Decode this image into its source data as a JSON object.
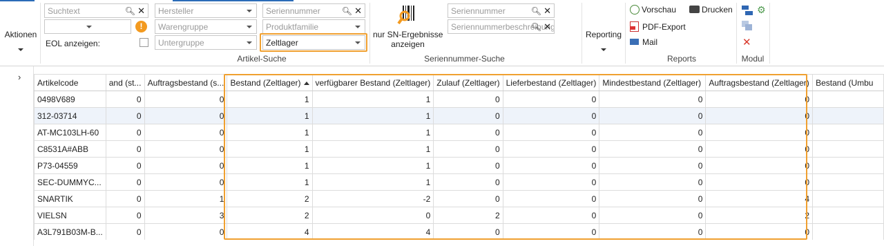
{
  "ribbon": {
    "aktionen": "Aktionen",
    "artikel_suche": {
      "group_label": "Artikel-Suche",
      "suchtext_placeholder": "Suchtext",
      "hersteller_placeholder": "Hersteller",
      "seriennummer_placeholder": "Seriennummer",
      "warengruppe_placeholder": "Warengruppe",
      "produktfamilie_placeholder": "Produktfamilie",
      "untergruppe_placeholder": "Untergruppe",
      "lager_value": "Zeltlager",
      "eol_label": "EOL anzeigen:",
      "info_icon_glyph": "!"
    },
    "sn_suche": {
      "group_label": "Seriennummer-Suche",
      "button_label_line1": "nur SN-Ergebnisse",
      "button_label_line2": "anzeigen",
      "seriennummer_placeholder": "Seriennummer",
      "beschreibung_placeholder": "Seriennummerbeschreibung"
    },
    "reporting": {
      "label": "Reporting"
    },
    "reports": {
      "group_label": "Reports",
      "vorschau": "Vorschau",
      "drucken": "Drucken",
      "pdf_export": "PDF-Export",
      "mail": "Mail"
    },
    "modul": {
      "group_label": "Modul"
    }
  },
  "highlight_color": "#f0a030",
  "grid": {
    "columns": [
      "Artikelcode",
      "and (st...",
      "Auftragsbestand (s...",
      "Bestand (Zeltlager)",
      "verfügbarer Bestand (Zeltlager)",
      "Zulauf (Zeltlager)",
      "Lieferbestand (Zeltlager)",
      "Mindestbestand (Zeltlager)",
      "Auftragsbestand (Zeltlager)",
      "Bestand (Umbu"
    ],
    "rows": [
      [
        "0498V689",
        "0",
        "0",
        "1",
        "1",
        "0",
        "0",
        "0",
        "0",
        ""
      ],
      [
        "312-03714",
        "0",
        "0",
        "1",
        "1",
        "0",
        "0",
        "0",
        "0",
        ""
      ],
      [
        "AT-MC103LH-60",
        "0",
        "0",
        "1",
        "1",
        "0",
        "0",
        "0",
        "0",
        ""
      ],
      [
        "C8531A#ABB",
        "0",
        "0",
        "1",
        "1",
        "0",
        "0",
        "0",
        "0",
        ""
      ],
      [
        "P73-04559",
        "0",
        "0",
        "1",
        "1",
        "0",
        "0",
        "0",
        "0",
        ""
      ],
      [
        "SEC-DUMMYC...",
        "0",
        "0",
        "1",
        "1",
        "0",
        "0",
        "0",
        "0",
        ""
      ],
      [
        "SNARTIK",
        "0",
        "1",
        "2",
        "-2",
        "0",
        "0",
        "0",
        "4",
        ""
      ],
      [
        "VIELSN",
        "0",
        "3",
        "2",
        "0",
        "2",
        "0",
        "0",
        "2",
        ""
      ],
      [
        "A3L791B03M-B...",
        "0",
        "0",
        "4",
        "4",
        "0",
        "0",
        "0",
        "0",
        ""
      ]
    ]
  }
}
